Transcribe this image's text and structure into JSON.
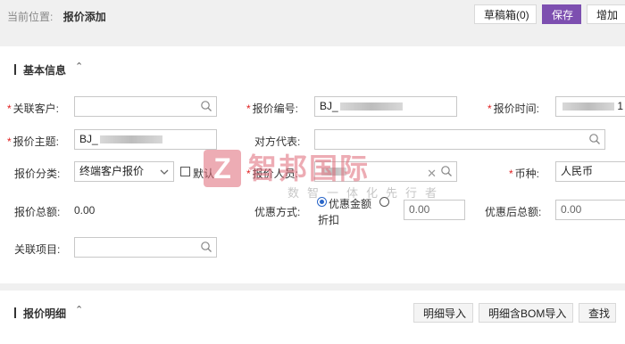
{
  "header": {
    "breadcrumb_label": "当前位置:",
    "breadcrumb_page": "报价添加",
    "draft_button": "草稿箱(0)",
    "save_button": "保存",
    "add_button": "增加"
  },
  "basic_section": {
    "title": "基本信息",
    "collapse_glyph": "⌃"
  },
  "form": {
    "customer_label": "关联客户:",
    "quote_no_label": "报价编号:",
    "quote_no_value": "BJ_",
    "quote_time_label": "报价时间:",
    "quote_time_suffix": "1",
    "subject_label": "报价主题:",
    "subject_value": "BJ_",
    "counterpart_label": "对方代表:",
    "category_label": "报价分类:",
    "category_value": "终端客户报价",
    "default_label": "默认",
    "staff_label": "报价人员:",
    "currency_label": "币种:",
    "currency_value": "人民币",
    "total_label": "报价总额:",
    "total_value": "0.00",
    "discount_mode_label": "优惠方式:",
    "discount_option1": "优惠金额",
    "discount_option2": "折扣",
    "discount_value": "0.00",
    "after_discount_label": "优惠后总额:",
    "after_discount_value": "0.00",
    "project_label": "关联项目:"
  },
  "detail_section": {
    "title": "报价明细",
    "collapse_glyph": "⌃",
    "import_button": "明细导入",
    "bom_import_button": "明细含BOM导入",
    "find_button": "查找"
  },
  "watermark": {
    "logo": "Z",
    "name": "智邦国际",
    "slogan": "数智一体化先行者"
  },
  "colors": {
    "primary": "#7d4fb0",
    "required": "#e02020",
    "topbar": "#f0f0f0"
  },
  "icons": {
    "search": "magnifier-icon",
    "clear": "clear-icon",
    "dropdown": "chevron-down-icon"
  }
}
